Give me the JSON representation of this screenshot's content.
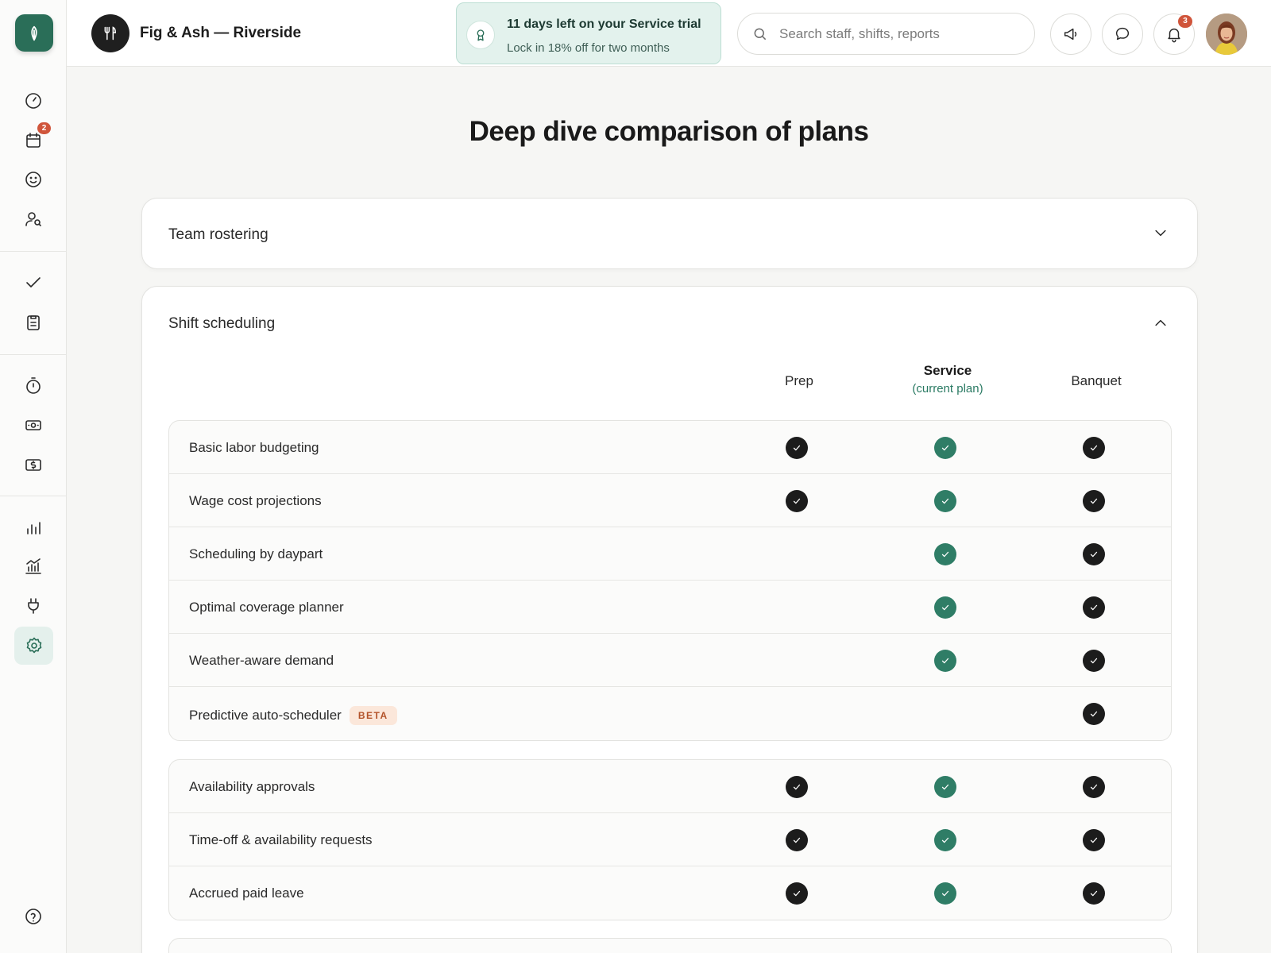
{
  "header": {
    "brand_name": "Fig & Ash — Riverside",
    "trial_title": "11 days left on your Service trial",
    "trial_subtitle": "Lock in 18% off for two months",
    "search_placeholder": "Search staff, shifts, reports",
    "notification_count": "3"
  },
  "sidebar": {
    "schedule_badge": "2",
    "icons": [
      "dashboard-icon",
      "calendar-icon",
      "smiley-icon",
      "people-icon",
      "check-icon",
      "clipboard-icon",
      "timer-icon",
      "cash-icon",
      "dollar-icon",
      "bar-chart-icon",
      "analytics-icon",
      "plug-icon",
      "gear-icon",
      "help-icon"
    ],
    "active": "gear-icon"
  },
  "page": {
    "title": "Deep dive comparison of plans"
  },
  "sections": [
    {
      "title": "Team rostering",
      "expanded": false
    },
    {
      "title": "Shift scheduling",
      "expanded": true
    }
  ],
  "plans": {
    "prep": "Prep",
    "service": "Service",
    "service_note": "(current plan)",
    "banquet": "Banquet"
  },
  "colors": {
    "accent": "#2f7d66",
    "dark_check": "#1c1c1c",
    "badge": "#d0553b"
  },
  "groups": [
    {
      "rows": [
        {
          "label": "Basic labor budgeting",
          "prep": true,
          "service": true,
          "banquet": true
        },
        {
          "label": "Wage cost projections",
          "prep": true,
          "service": true,
          "banquet": true
        },
        {
          "label": "Scheduling by daypart",
          "prep": false,
          "service": true,
          "banquet": true
        },
        {
          "label": "Optimal coverage planner",
          "prep": false,
          "service": true,
          "banquet": true
        },
        {
          "label": "Weather-aware demand",
          "prep": false,
          "service": true,
          "banquet": true
        },
        {
          "label": "Predictive auto-scheduler",
          "badge": "BETA",
          "prep": false,
          "service": false,
          "banquet": true
        }
      ]
    },
    {
      "rows": [
        {
          "label": "Availability approvals",
          "prep": true,
          "service": true,
          "banquet": true
        },
        {
          "label": "Time-off & availability requests",
          "prep": true,
          "service": true,
          "banquet": true
        },
        {
          "label": "Accrued paid leave",
          "prep": true,
          "service": true,
          "banquet": true
        }
      ]
    }
  ]
}
